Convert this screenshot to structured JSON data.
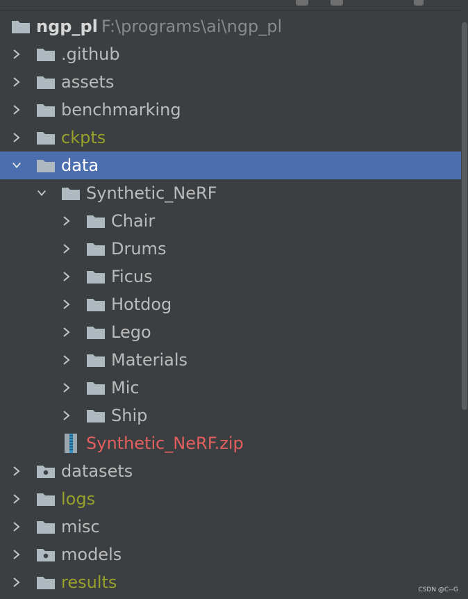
{
  "root": {
    "name": "ngp_pl",
    "path": "F:\\programs\\ai\\ngp_pl"
  },
  "tree": {
    "github": ".github",
    "assets": "assets",
    "benchmarking": "benchmarking",
    "ckpts": "ckpts",
    "data": "data",
    "synthetic_nerf": "Synthetic_NeRF",
    "chair": "Chair",
    "drums": "Drums",
    "ficus": "Ficus",
    "hotdog": "Hotdog",
    "lego": "Lego",
    "materials": "Materials",
    "mic": "Mic",
    "ship": "Ship",
    "zip": "Synthetic_NeRF.zip",
    "datasets": "datasets",
    "logs": "logs",
    "misc": "misc",
    "models": "models",
    "results": "results"
  },
  "colors": {
    "background": "#3c3f41",
    "selection": "#4b6eaf",
    "excluded_text": "#98a02c",
    "untracked_text": "#e35f5f",
    "default_text": "#bbbbbb"
  },
  "watermark": "CSDN @C--G"
}
